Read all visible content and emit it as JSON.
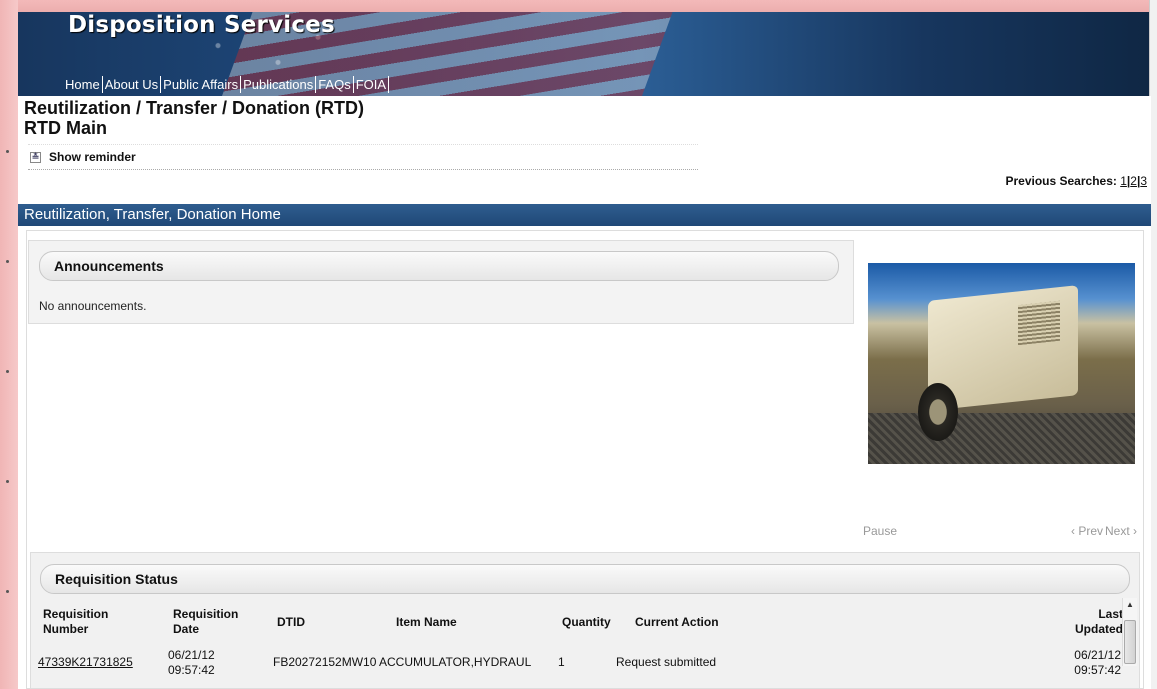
{
  "header": {
    "brand": "Disposition Services",
    "nav": [
      "Home",
      "About Us",
      "Public Affairs",
      "Publications",
      "FAQs",
      "FOIA"
    ]
  },
  "page": {
    "title": "Reutilization / Transfer / Donation (RTD)",
    "subtitle": "RTD Main",
    "reminder_label": "Show reminder",
    "previous_searches_label": "Previous Searches:",
    "previous_searches": [
      "1",
      "2",
      "3"
    ],
    "section_title": "Reutilization, Transfer, Donation Home"
  },
  "announcements": {
    "title": "Announcements",
    "message": "No announcements."
  },
  "slideshow": {
    "pause_label": "Pause",
    "prev_label": "‹ Prev",
    "next_label": "Next ›"
  },
  "requisition": {
    "title": "Requisition Status",
    "columns": [
      "Requisition Number",
      "Requisition Date",
      "DTID",
      "Item Name",
      "Quantity",
      "Current Action",
      "Last Updated"
    ],
    "rows": [
      {
        "number": "47339K21731825",
        "date": "06/21/12",
        "time": "09:57:42",
        "dtid": "FB20272152MW10",
        "item": "ACCUMULATOR,HYDRAUL",
        "quantity": "1",
        "action": "Request submitted",
        "updated_date": "06/21/12",
        "updated_time": "09:57:42"
      }
    ]
  },
  "colors": {
    "banner": "#1f4a7e",
    "section_bar": "#2a5686",
    "frame": "#e9a8a8"
  }
}
